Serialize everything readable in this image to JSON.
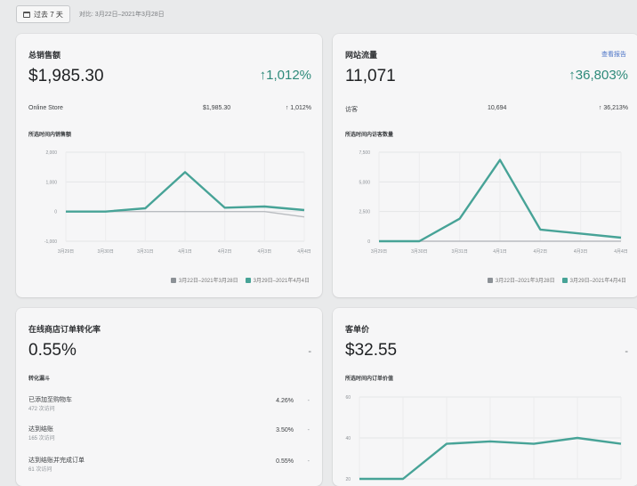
{
  "topbar": {
    "date_label": "过去 7 天",
    "compare_label": "对比: 3月22日–2021年3月28日"
  },
  "sales": {
    "title": "总销售额",
    "value": "$1,985.30",
    "delta": "↑1,012%",
    "breakdown": {
      "label": "Online Store",
      "value": "$1,985.30",
      "delta": "↑ 1,012%"
    },
    "chart_title": "所选时间内销售额",
    "legend": [
      "3月22日–2021年3月28日",
      "3月29日–2021年4月4日"
    ]
  },
  "traffic": {
    "title": "网站流量",
    "link": "查看报告",
    "value": "11,071",
    "delta": "↑36,803%",
    "breakdown": {
      "label": "访客",
      "value": "10,694",
      "delta": "↑ 36,213%"
    },
    "chart_title": "所选时间内访客数量",
    "legend": [
      "3月22日–2021年3月28日",
      "3月29日–2021年4月4日"
    ]
  },
  "conversion": {
    "title": "在线商店订单转化率",
    "value": "0.55%",
    "dash": "-",
    "subhead": "转化漏斗",
    "rows": [
      {
        "label": "已添加至购物车",
        "sub": "472 次访问",
        "pct": "4.26%",
        "dash": "-"
      },
      {
        "label": "达到结账",
        "sub": "165 次访问",
        "pct": "3.50%",
        "dash": "-"
      },
      {
        "label": "达到结账并完成订单",
        "sub": "61 次访问",
        "pct": "0.55%",
        "dash": "-"
      }
    ]
  },
  "aov": {
    "title": "客单价",
    "value": "$32.55",
    "dash": "-",
    "chart_title": "所选时间内订单价值"
  },
  "colors": {
    "accent": "#47a397",
    "previous": "#b9bcc0",
    "link": "#4c74c7",
    "positive": "#2e8a7a"
  },
  "chart_data": [
    {
      "type": "line",
      "x": [
        "3月29日",
        "3月30日",
        "3月31日",
        "4月1日",
        "4月2日",
        "4月3日",
        "4月4日"
      ],
      "ylim": [
        -1000,
        2000
      ],
      "yticks": [
        "2,000",
        "1,000",
        "0",
        "-1,000"
      ],
      "series": [
        {
          "name": "3月29日–2021年4月4日",
          "values": [
            0,
            0,
            110,
            1330,
            130,
            170,
            50
          ]
        },
        {
          "name": "3月22日–2021年3月28日",
          "values": [
            0,
            0,
            0,
            0,
            0,
            0,
            -180
          ]
        }
      ]
    },
    {
      "type": "line",
      "x": [
        "3月29日",
        "3月30日",
        "3月31日",
        "4月1日",
        "4月2日",
        "4月3日",
        "4月4日"
      ],
      "ylim": [
        0,
        7500
      ],
      "yticks": [
        "7,500",
        "5,000",
        "2,500",
        "0"
      ],
      "series": [
        {
          "name": "3月29日–2021年4月4日",
          "values": [
            0,
            0,
            1900,
            6850,
            980,
            640,
            300
          ]
        },
        {
          "name": "3月22日–2021年3月28日",
          "values": [
            0,
            0,
            0,
            0,
            0,
            0,
            0
          ]
        }
      ]
    },
    {
      "type": "line",
      "yticks": [
        "60",
        "40",
        "20"
      ],
      "ylim": [
        0,
        70
      ],
      "series": [
        {
          "name": "3月29日–2021年4月4日",
          "values": [
            0,
            0,
            30,
            32,
            30,
            35,
            30
          ]
        }
      ]
    }
  ]
}
